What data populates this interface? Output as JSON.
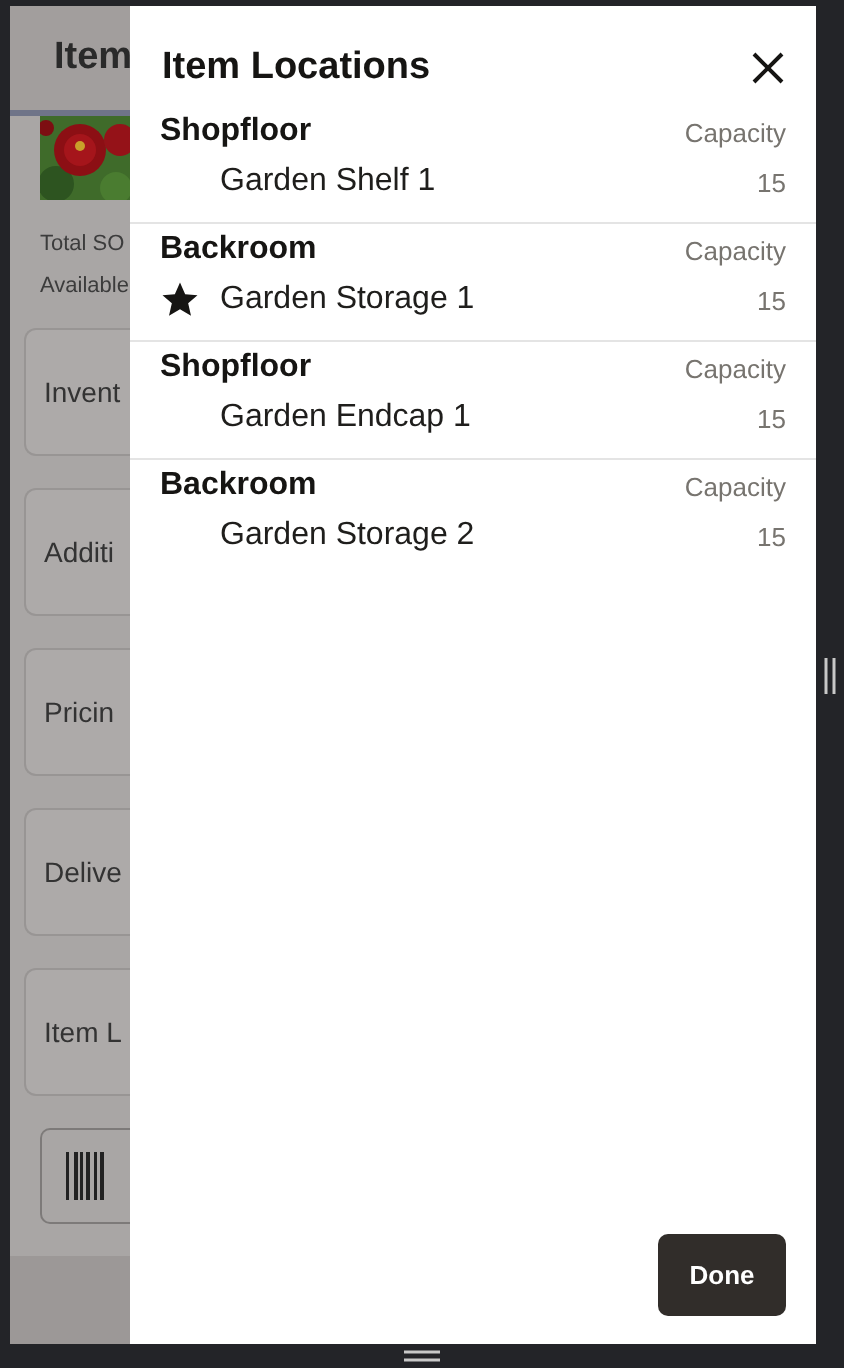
{
  "background_app": {
    "header_title": "Item",
    "summary": [
      "Total SO",
      "Available"
    ],
    "cards": [
      "Invent",
      "Additi",
      "Pricin",
      "Delive",
      "Item L"
    ]
  },
  "drawer": {
    "title": "Item Locations",
    "groups": [
      {
        "zone": "Shopfloor",
        "capacity_label": "Capacity",
        "location": "Garden Shelf 1",
        "capacity": "15",
        "primary": false
      },
      {
        "zone": "Backroom",
        "capacity_label": "Capacity",
        "location": "Garden Storage 1",
        "capacity": "15",
        "primary": true
      },
      {
        "zone": "Shopfloor",
        "capacity_label": "Capacity",
        "location": "Garden Endcap 1",
        "capacity": "15",
        "primary": false
      },
      {
        "zone": "Backroom",
        "capacity_label": "Capacity",
        "location": "Garden Storage 2",
        "capacity": "15",
        "primary": false
      }
    ],
    "done_button": "Done"
  }
}
